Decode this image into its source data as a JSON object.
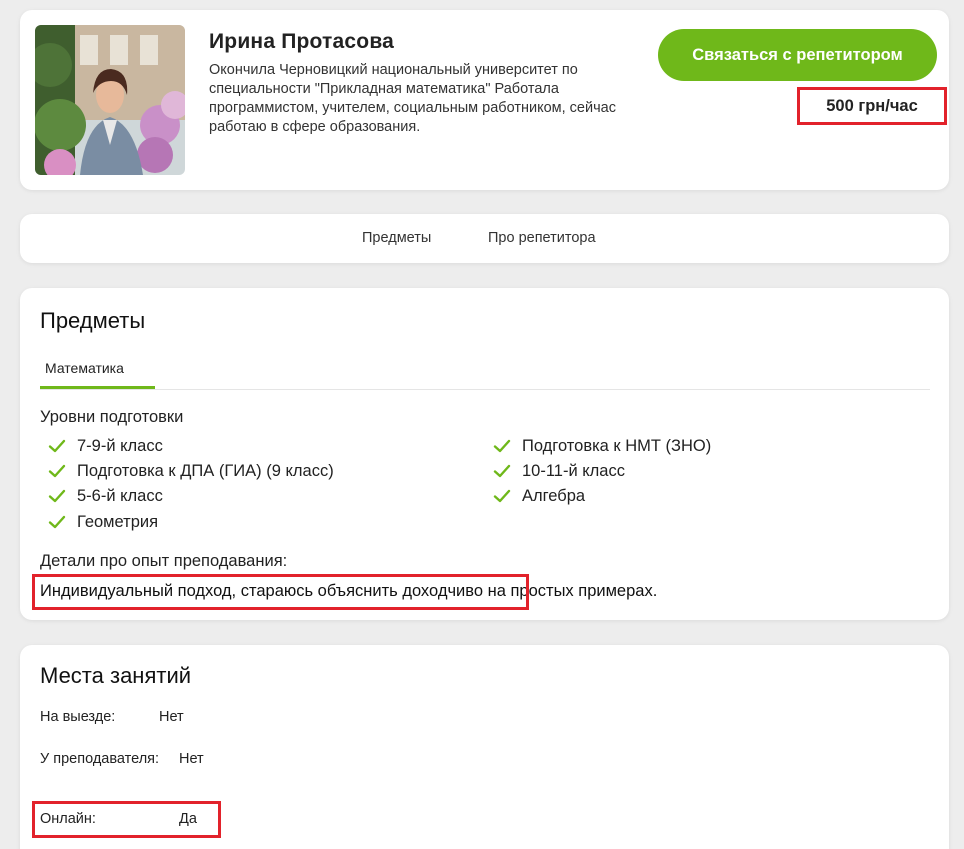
{
  "profile": {
    "name": "Ирина Протасова",
    "bio": "Окончила Черновицкий национальный университет по специальности \"Прикладная математика\" Работала программистом, учителем, социальным работником, сейчас работаю в сфере образования.",
    "contact_label": "Связаться с репетитором",
    "price": "500 грн/час"
  },
  "nav": {
    "items": [
      {
        "label": "Предметы"
      },
      {
        "label": "Про репетитора"
      }
    ]
  },
  "subjects": {
    "title": "Предметы",
    "tab": "Математика",
    "levels_title": "Уровни подготовки",
    "levels_left": [
      "7-9-й класс",
      "Подготовка к ДПА (ГИА) (9 класс)",
      "5-6-й класс",
      "Геометрия"
    ],
    "levels_right": [
      "Подготовка к НМТ (ЗНО)",
      "10-11-й класс",
      "Алгебра"
    ],
    "details_title": "Детали про опыт преподавания:",
    "details_text": "Индивидуальный подход, стараюсь объяснить доходчиво на простых примерах."
  },
  "places": {
    "title": "Места занятий",
    "rows": [
      {
        "label": "На выезде:",
        "value": "Нет"
      },
      {
        "label": "У преподавателя:",
        "value": "Нет"
      },
      {
        "label": "Онлайн:",
        "value": "Да"
      }
    ]
  },
  "colors": {
    "accent_green": "#6fb81a",
    "highlight_red": "#e2222b",
    "background": "#ededed"
  },
  "icons": [
    "check-icon"
  ]
}
